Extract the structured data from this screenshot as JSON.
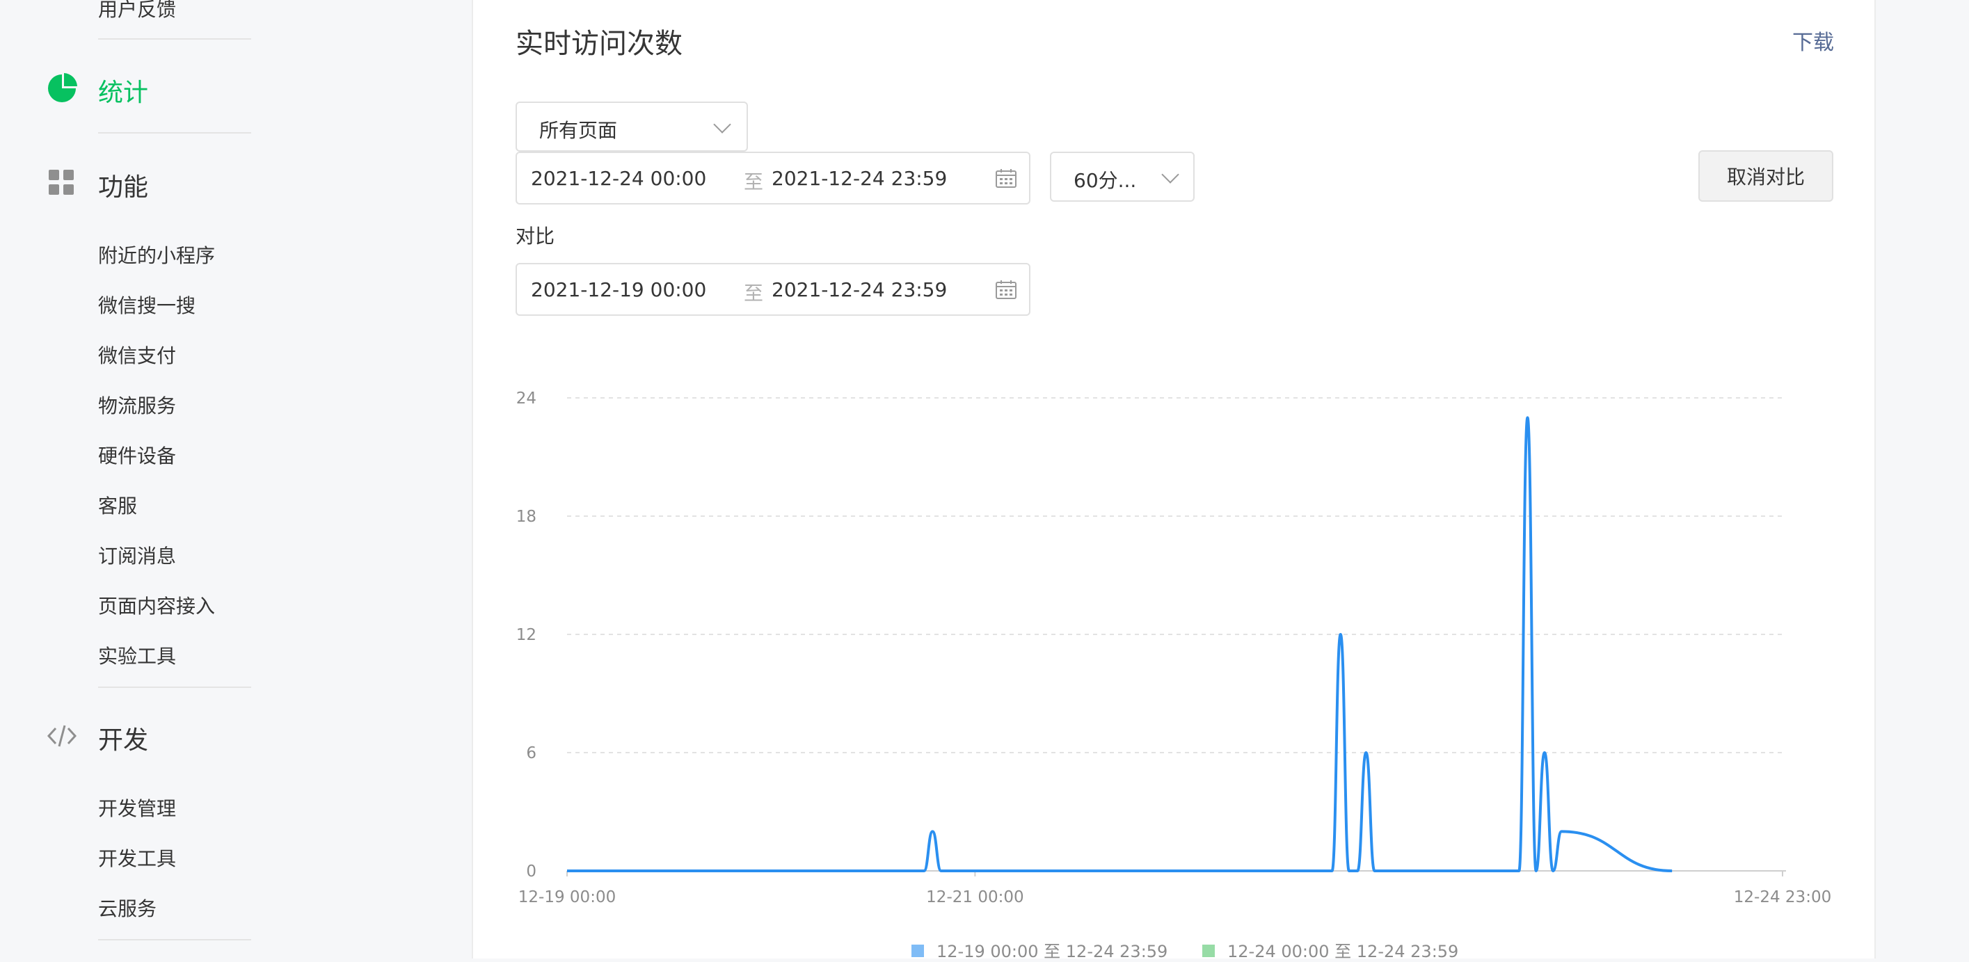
{
  "sidebar": {
    "top_item": "用户反馈",
    "stats": {
      "label": "统计",
      "icon": "pie-chart-icon"
    },
    "features": {
      "label": "功能",
      "icon": "grid-icon"
    },
    "feature_items": [
      "附近的小程序",
      "微信搜一搜",
      "微信支付",
      "物流服务",
      "硬件设备",
      "客服",
      "订阅消息",
      "页面内容接入",
      "实验工具"
    ],
    "dev": {
      "label": "开发",
      "icon": "code-icon"
    },
    "dev_items": [
      "开发管理",
      "开发工具",
      "云服务"
    ]
  },
  "main": {
    "title": "实时访问次数",
    "download": "下载",
    "page_select": "所有页面",
    "range": {
      "start": "2021-12-24 00:00",
      "to": "至",
      "end": "2021-12-24 23:59"
    },
    "interval": "60分...",
    "cancel_compare": "取消对比",
    "compare_label": "对比",
    "compare_range": {
      "start": "2021-12-19 00:00",
      "to": "至",
      "end": "2021-12-24 23:59"
    }
  },
  "colors": {
    "active": "#07c160",
    "link": "#576b95",
    "series_blue": "#2a8ff0",
    "series_green": "#52c46a"
  },
  "chart_data": {
    "type": "line",
    "title": "",
    "xlabel": "",
    "ylabel": "",
    "x_ticks": [
      "12-19 00:00",
      "12-21 00:00",
      "12-24 23:00"
    ],
    "x_tick_hours": [
      0,
      48,
      143
    ],
    "ylim": [
      0,
      24
    ],
    "y_ticks": [
      0,
      6,
      12,
      18,
      24
    ],
    "grid": true,
    "legend_placement": "bottom",
    "series": [
      {
        "name": "12-19 00:00 至 12-24 23:59",
        "color": "#2a8ff0",
        "x_hours": [
          0,
          42,
          43,
          44,
          90,
          91,
          92,
          93,
          94,
          95,
          112,
          113,
          114,
          115,
          116,
          117,
          130
        ],
        "y": [
          0,
          0,
          2,
          0,
          0,
          12,
          0,
          0,
          6,
          0,
          0,
          23,
          0,
          6,
          0,
          2,
          0
        ]
      },
      {
        "name": "12-24 00:00 至 12-24 23:59",
        "color": "#52c46a",
        "x_hours": [
          0,
          10
        ],
        "y": [
          0,
          0
        ]
      }
    ]
  }
}
